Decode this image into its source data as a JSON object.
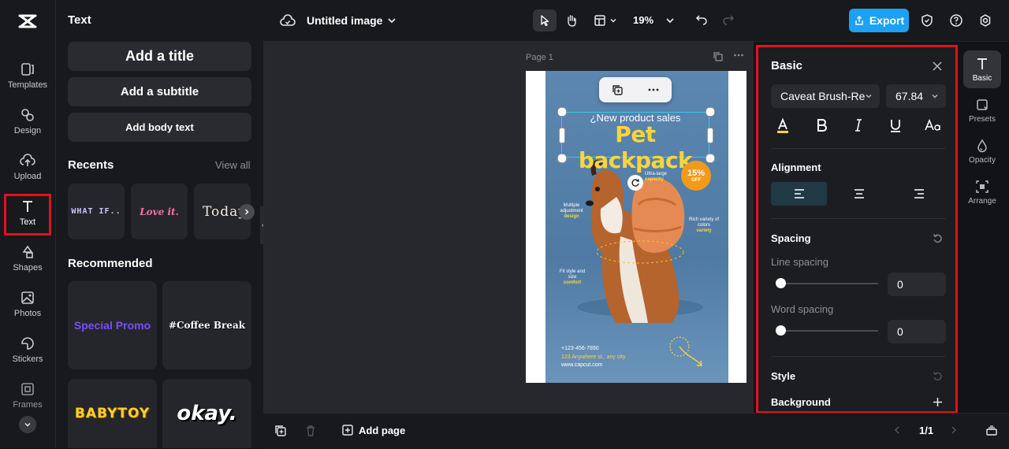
{
  "rail": {
    "items": [
      {
        "label": "Templates",
        "icon": "templates-icon"
      },
      {
        "label": "Design",
        "icon": "design-icon"
      },
      {
        "label": "Upload",
        "icon": "upload-icon"
      },
      {
        "label": "Text",
        "icon": "text-icon"
      },
      {
        "label": "Shapes",
        "icon": "shapes-icon"
      },
      {
        "label": "Photos",
        "icon": "photos-icon"
      },
      {
        "label": "Stickers",
        "icon": "stickers-icon"
      },
      {
        "label": "Frames",
        "icon": "frames-icon"
      }
    ]
  },
  "panel": {
    "title": "Text",
    "add_title": "Add a title",
    "add_subtitle": "Add a subtitle",
    "add_body": "Add body text",
    "recents_label": "Recents",
    "view_all": "View all",
    "recents": [
      "WHAT IF..",
      "Love it.",
      "Today"
    ],
    "recommended_label": "Recommended",
    "recommended": [
      "Special Promo",
      "#Coffee Break",
      "BABYTOY",
      "okay."
    ]
  },
  "topbar": {
    "doc_title": "Untitled image",
    "zoom": "19%",
    "export_label": "Export"
  },
  "canvas": {
    "page_label": "Page 1",
    "poster": {
      "subtitle": "¿New product sales",
      "title": "Pet backpack",
      "discount": "15%",
      "discount_sub": "OFF",
      "features": [
        {
          "line1": "Ultra-large",
          "line2": "capacity"
        },
        {
          "line1": "Multiple adjustment",
          "line2": "design"
        },
        {
          "line1": "Rich variety of colors",
          "line2": "variety"
        },
        {
          "line1": "Fit style and size",
          "line2": "comfort"
        }
      ],
      "contact": [
        "+123-456-7890",
        "123 Anywhere st., any city",
        "www.capcut.com"
      ]
    }
  },
  "props": {
    "title": "Basic",
    "font": "Caveat Brush-Re",
    "size": "67.84",
    "alignment_label": "Alignment",
    "spacing_label": "Spacing",
    "line_spacing_label": "Line spacing",
    "line_spacing_value": "0",
    "word_spacing_label": "Word spacing",
    "word_spacing_value": "0",
    "style_label": "Style",
    "background_label": "Background"
  },
  "rtools": {
    "items": [
      {
        "label": "Basic"
      },
      {
        "label": "Presets"
      },
      {
        "label": "Opacity"
      },
      {
        "label": "Arrange"
      }
    ]
  },
  "bottombar": {
    "add_page": "Add page",
    "page_counter": "1/1"
  },
  "colors": {
    "accent": "#1da1f2",
    "highlight": "#e0121f",
    "poster_bg": "#5a86b0",
    "poster_title": "#ffd43b"
  }
}
